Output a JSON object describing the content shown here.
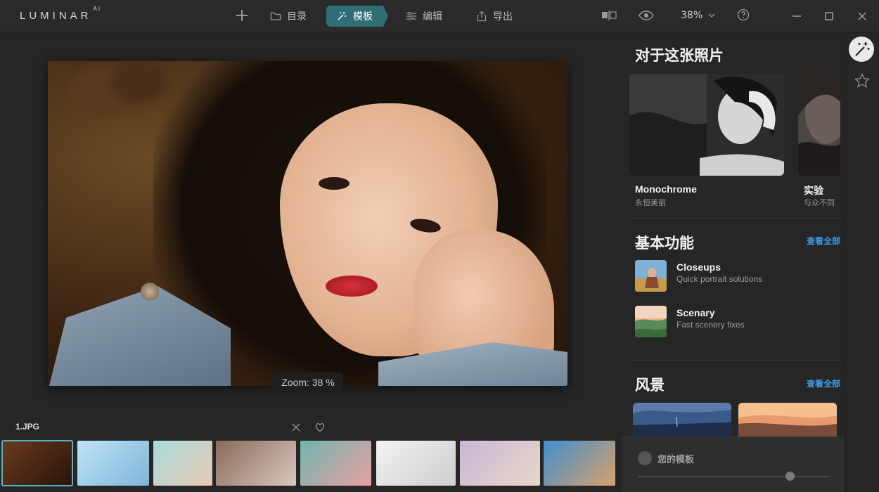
{
  "app": {
    "logo": "LUMINAR",
    "logo_suffix": "AI"
  },
  "nav": {
    "catalog": "目录",
    "templates": "模板",
    "edit": "编辑",
    "export": "导出"
  },
  "toolbar": {
    "zoom_value": "38%"
  },
  "canvas": {
    "zoom_label": "Zoom: 38 %"
  },
  "filmstrip": {
    "file_name": "1.JPG",
    "thumbs": [
      {
        "name": "thumb-1",
        "bg": "linear-gradient(135deg,#6a3a1e,#2a140a)",
        "selected": true
      },
      {
        "name": "thumb-2",
        "bg": "linear-gradient(135deg,#bfe3f6,#7fb5d8)"
      },
      {
        "name": "thumb-3",
        "bg": "linear-gradient(135deg,#a9dcdc,#e8c9b5)"
      },
      {
        "name": "thumb-4",
        "bg": "linear-gradient(135deg,#8a6a5a,#d8c8c0)"
      },
      {
        "name": "thumb-5",
        "bg": "linear-gradient(135deg,#6fb6b0,#e8a0a0)"
      },
      {
        "name": "thumb-6",
        "bg": "linear-gradient(135deg,#f2f2f2,#cfcfcf)"
      },
      {
        "name": "thumb-7",
        "bg": "linear-gradient(135deg,#c9b7d8,#e8d8c8)"
      },
      {
        "name": "thumb-8",
        "bg": "linear-gradient(135deg,#3f8fd0,#d9a06a)"
      }
    ]
  },
  "panel": {
    "about_title": "对于这张照片",
    "cards": [
      {
        "title": "Monochrome",
        "subtitle": "永恒美丽"
      },
      {
        "title": "实验",
        "subtitle": "与众不同"
      }
    ],
    "basics_title": "基本功能",
    "basics_see_all": "查看全部",
    "items": [
      {
        "title": "Closeups",
        "subtitle": "Quick portrait solutions"
      },
      {
        "title": "Scenary",
        "subtitle": "Fast scenery fixes"
      }
    ],
    "landscape_title": "风景",
    "landscape_see_all": "查看全部",
    "my_templates": "您的模板"
  },
  "colors": {
    "accent": "#2f6e74",
    "link": "#3f9be8",
    "selected_outline": "#4fb6c6"
  }
}
